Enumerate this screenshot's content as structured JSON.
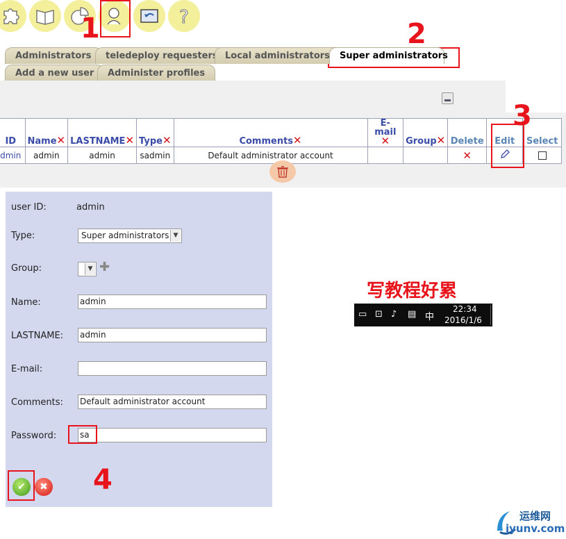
{
  "toolbar": {
    "icons": [
      "puzzle-icon",
      "book-icon",
      "pie-chart-icon",
      "user-admin-icon",
      "back-icon",
      "help-icon"
    ]
  },
  "annotations": {
    "n1": "1",
    "n2": "2",
    "n3": "3",
    "n4": "4",
    "color": "#e8141b"
  },
  "tabs": {
    "row1": [
      "Administrators",
      "teledeploy requesters",
      "Local administrators",
      "Super administrators"
    ],
    "row2": [
      "Add a new user",
      "Administer profiles"
    ],
    "active": "Super administrators"
  },
  "table": {
    "headers": {
      "id": "ID",
      "name": "Name",
      "lastname": "LASTNAME",
      "type": "Type",
      "comments": "Comments",
      "email": "E-mail",
      "group": "Group",
      "delete": "Delete",
      "edit": "Edit",
      "select": "Select"
    },
    "rows": [
      {
        "id": "dmin",
        "name": "admin",
        "lastname": "admin",
        "type": "sadmin",
        "comments": "Default administrator account",
        "email": "",
        "group": ""
      }
    ]
  },
  "form": {
    "userid_label": "user ID:",
    "userid_value": "admin",
    "type_label": "Type:",
    "type_value": "Super administrators",
    "group_label": "Group:",
    "group_value": "",
    "name_label": "Name:",
    "name_value": "admin",
    "lastname_label": "LASTNAME:",
    "lastname_value": "admin",
    "email_label": "E-mail:",
    "email_value": "",
    "comments_label": "Comments:",
    "comments_value": "Default administrator account",
    "password_label": "Password:",
    "password_value": "sa"
  },
  "caption": "写教程好累",
  "taskbar": {
    "time": "22:34",
    "date": "2016/1/6",
    "ime": "中"
  },
  "watermark": {
    "cn": "运维网",
    "en": "iyunv.com"
  }
}
